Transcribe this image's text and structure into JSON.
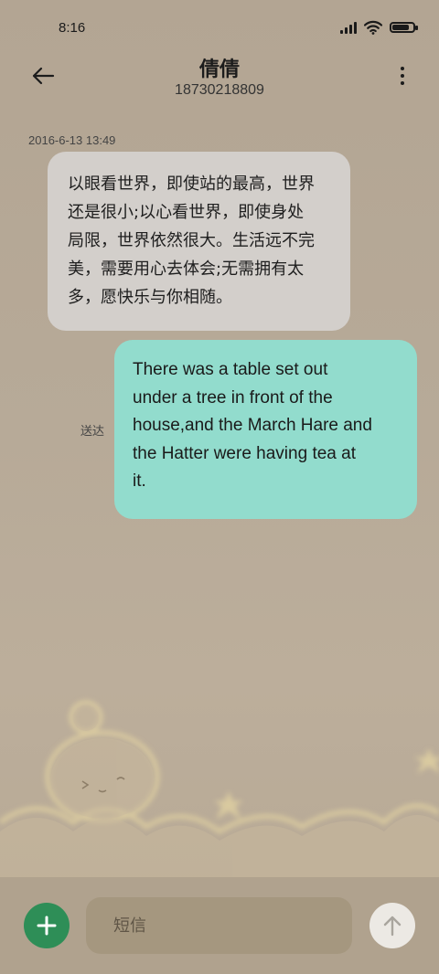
{
  "status_bar": {
    "time": "8:16",
    "signal_icon": "signal-icon",
    "wifi_icon": "wifi-icon",
    "battery_icon": "battery-icon",
    "battery_level": 0.85
  },
  "header": {
    "contact_name": "倩倩",
    "contact_number": "18730218809",
    "back_icon": "back-arrow-icon",
    "menu_icon": "more-vert-icon"
  },
  "conversation": {
    "timestamp": "2016-6-13 13:49",
    "messages": [
      {
        "direction": "incoming",
        "lines": [
          "以眼看世界，即使站的最高，世界",
          "还是很小;以心看世界，即使身处",
          "局限，世界依然很大。生活远不完",
          "美，需要用心去体会;无需拥有太",
          "多，愿快乐与你相随。"
        ]
      },
      {
        "direction": "outgoing",
        "lines": [
          "There was a table set out",
          "under a tree in front of the",
          "house,and the March Hare and",
          "the Hatter were having tea at",
          "it."
        ],
        "status": "送达"
      }
    ]
  },
  "compose": {
    "placeholder": "短信",
    "add_icon": "plus-icon",
    "send_icon": "send-arrow-icon"
  },
  "colors": {
    "incoming_bubble": "#d3cfcb",
    "outgoing_bubble": "#92dccd",
    "add_button": "#2e8e57",
    "send_button": "#ece9e4",
    "background": "#b7aa98"
  }
}
